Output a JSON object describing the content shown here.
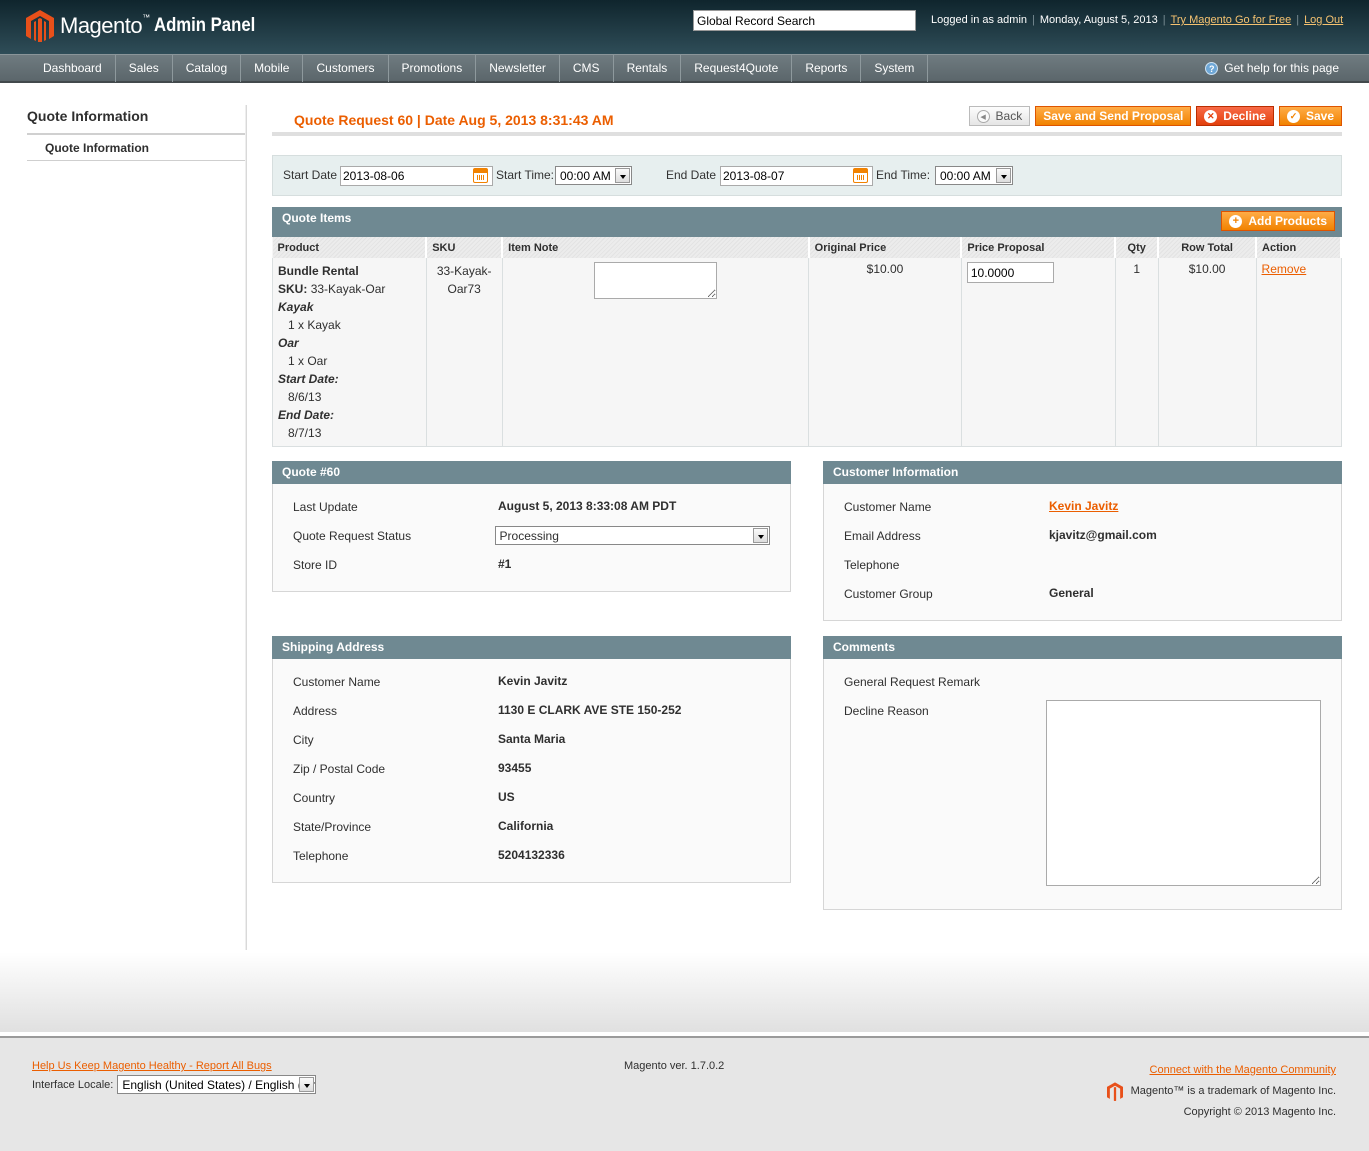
{
  "header": {
    "logo_text": "Magento",
    "logo_tm": "™",
    "logo_sub": "Admin Panel",
    "search_value": "Global Record Search",
    "logged_in": "Logged in as admin",
    "date": "Monday, August 5, 2013",
    "try_link": "Try Magento Go for Free",
    "logout_link": "Log Out"
  },
  "nav": {
    "items": [
      "Dashboard",
      "Sales",
      "Catalog",
      "Mobile",
      "Customers",
      "Promotions",
      "Newsletter",
      "CMS",
      "Rentals",
      "Request4Quote",
      "Reports",
      "System"
    ],
    "help": "Get help for this page"
  },
  "sidebar": {
    "title": "Quote Information",
    "items": [
      {
        "label": "Quote Information"
      }
    ]
  },
  "content": {
    "title": "Quote Request 60 | Date Aug 5, 2013 8:31:43 AM",
    "buttons": {
      "back": "Back",
      "save_send": "Save and Send Proposal",
      "decline": "Decline",
      "save": "Save"
    }
  },
  "dates": {
    "start_date_label": "Start Date",
    "start_date": "2013-08-06",
    "start_time_label": "Start Time:",
    "start_time": "00:00 AM",
    "end_date_label": "End Date",
    "end_date": "2013-08-07",
    "end_time_label": "End Time:",
    "end_time": "00:00 AM"
  },
  "quote_items": {
    "title": "Quote Items",
    "add_button": "Add Products",
    "columns": [
      "Product",
      "SKU",
      "Item Note",
      "Original Price",
      "Price Proposal",
      "Qty",
      "Row Total",
      "Action"
    ],
    "rows": [
      {
        "product_name": "Bundle Rental",
        "sku_label": "SKU:",
        "sku_inline": "33-Kayak-Oar",
        "options": [
          {
            "label": "Kayak",
            "value": "1 x Kayak"
          },
          {
            "label": "Oar",
            "value": "1 x Oar"
          },
          {
            "label": "Start Date:",
            "value": "8/6/13"
          },
          {
            "label": "End Date:",
            "value": "8/7/13"
          }
        ],
        "sku_line1": "33-Kayak-",
        "sku_line2": "Oar73",
        "item_note": "",
        "original_price": "$10.00",
        "price_proposal": "10.0000",
        "qty": "1",
        "row_total": "$10.00",
        "action": "Remove"
      }
    ]
  },
  "quote_box": {
    "title": "Quote #60",
    "last_update_label": "Last Update",
    "last_update": "August 5, 2013 8:33:08 AM PDT",
    "status_label": "Quote Request Status",
    "status": "Processing",
    "store_label": "Store ID",
    "store": "#1"
  },
  "customer_box": {
    "title": "Customer Information",
    "name_label": "Customer Name",
    "name": "Kevin Javitz",
    "email_label": "Email Address",
    "email": "kjavitz@gmail.com",
    "phone_label": "Telephone",
    "phone": "",
    "group_label": "Customer Group",
    "group": "General"
  },
  "shipping_box": {
    "title": "Shipping Address",
    "rows": [
      {
        "label": "Customer Name",
        "value": "Kevin Javitz"
      },
      {
        "label": "Address",
        "value": "1130 E CLARK AVE STE 150-252"
      },
      {
        "label": "City",
        "value": "Santa Maria"
      },
      {
        "label": "Zip / Postal Code",
        "value": "93455"
      },
      {
        "label": "Country",
        "value": "US"
      },
      {
        "label": "State/Province",
        "value": "California"
      },
      {
        "label": "Telephone",
        "value": "5204132336"
      }
    ]
  },
  "comments_box": {
    "title": "Comments",
    "remark_label": "General Request Remark",
    "remark": "",
    "decline_label": "Decline Reason",
    "decline_value": ""
  },
  "footer": {
    "bug_link": "Help Us Keep Magento Healthy - Report All Bugs",
    "locale_label": "Interface Locale:",
    "locale_value": "English (United States) / English (United States)",
    "version": "Magento ver. 1.7.0.2",
    "community_link": "Connect with the Magento Community",
    "trademark": "Magento™ is a trademark of Magento Inc.",
    "copyright": "Copyright © 2013 Magento Inc."
  },
  "colors": {
    "accent": "#eb5e00",
    "button_orange": "#f18200",
    "header_bar": "#6f8992"
  }
}
